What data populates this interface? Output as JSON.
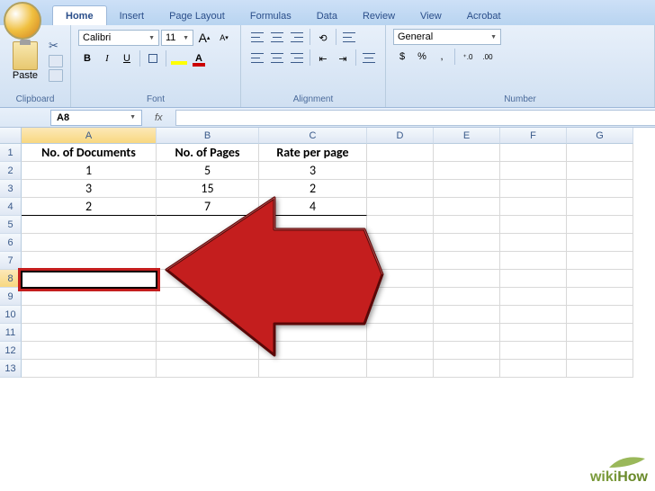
{
  "tabs": {
    "home": "Home",
    "insert": "Insert",
    "pagelayout": "Page Layout",
    "formulas": "Formulas",
    "data": "Data",
    "review": "Review",
    "view": "View",
    "acrobat": "Acrobat"
  },
  "ribbon": {
    "clipboard": {
      "title": "Clipboard",
      "paste": "Paste"
    },
    "font": {
      "title": "Font",
      "name": "Calibri",
      "size": "11",
      "bold": "B",
      "italic": "I",
      "underline": "U",
      "grow": "A",
      "shrink": "A"
    },
    "alignment": {
      "title": "Alignment"
    },
    "number": {
      "title": "Number",
      "format": "General",
      "currency": "$",
      "percent": "%",
      "comma": ",",
      "inc": ".0",
      "dec": ".00"
    }
  },
  "namebox": {
    "value": "A8"
  },
  "fx": {
    "label": "fx"
  },
  "columns": [
    "A",
    "B",
    "C",
    "D",
    "E",
    "F",
    "G"
  ],
  "rows": [
    "1",
    "2",
    "3",
    "4",
    "5",
    "6",
    "7",
    "8",
    "9",
    "10",
    "11",
    "12",
    "13"
  ],
  "headers": {
    "a": "No. of Documents",
    "b": "No. of Pages",
    "c": "Rate per page"
  },
  "data": [
    {
      "a": "1",
      "b": "5",
      "c": "3"
    },
    {
      "a": "3",
      "b": "15",
      "c": "2"
    },
    {
      "a": "2",
      "b": "7",
      "c": "4"
    }
  ],
  "watermark": {
    "wiki": "wiki",
    "how": "How"
  }
}
